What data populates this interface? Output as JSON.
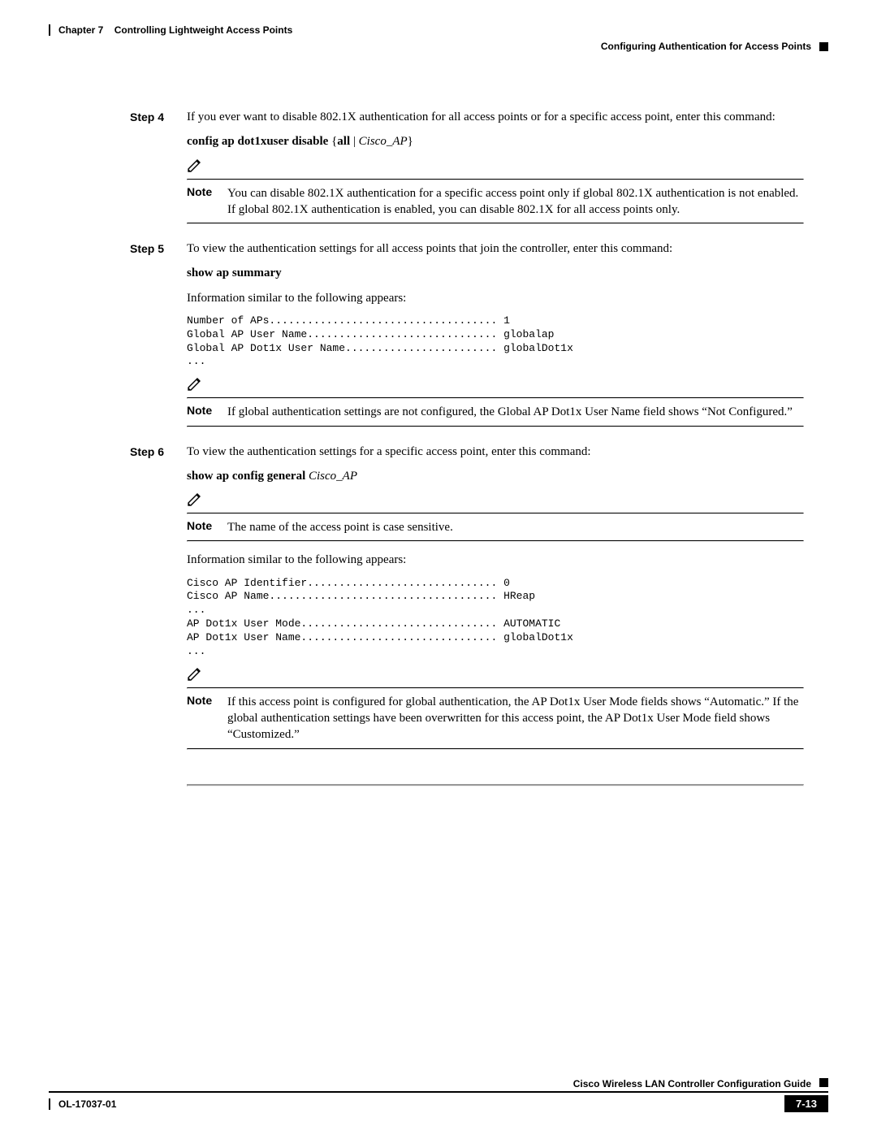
{
  "header": {
    "chapter_label": "Chapter 7",
    "chapter_title": "Controlling Lightweight Access Points",
    "section_title": "Configuring Authentication for Access Points"
  },
  "steps": {
    "s4": {
      "label": "Step 4",
      "intro": "If you ever want to disable 802.1X authentication for all access points or for a specific access point, enter this command:",
      "cmd_prefix": "config ap dot1xuser disable ",
      "cmd_brace_open": "{",
      "cmd_all": "all",
      "cmd_pipe": " | ",
      "cmd_arg": "Cisco_AP",
      "cmd_brace_close": "}",
      "note_label": "Note",
      "note_text": "You can disable 802.1X authentication for a specific access point only if global 802.1X authentication is not enabled. If global 802.1X authentication is enabled, you can disable 802.1X for all access points only."
    },
    "s5": {
      "label": "Step 5",
      "intro": "To view the authentication settings for all access points that join the controller, enter this command:",
      "cmd": "show ap summary",
      "info_line": "Information similar to the following appears:",
      "output": "Number of APs.................................... 1\nGlobal AP User Name.............................. globalap\nGlobal AP Dot1x User Name........................ globalDot1x\n...",
      "note_label": "Note",
      "note_text": "If global authentication settings are not configured, the Global AP Dot1x User Name field shows “Not Configured.”"
    },
    "s6": {
      "label": "Step 6",
      "intro": "To view the authentication settings for a specific access point, enter this command:",
      "cmd_prefix": "show ap config general ",
      "cmd_arg": "Cisco_AP",
      "note1_label": "Note",
      "note1_text": "The name of the access point is case sensitive.",
      "info_line": "Information similar to the following appears:",
      "output": "Cisco AP Identifier.............................. 0\nCisco AP Name.................................... HReap\n...\nAP Dot1x User Mode............................... AUTOMATIC\nAP Dot1x User Name............................... globalDot1x\n...",
      "note2_label": "Note",
      "note2_text": "If this access point is configured for global authentication, the AP Dot1x User Mode fields shows “Automatic.” If the global authentication settings have been overwritten for this access point, the AP Dot1x User Mode field shows “Customized.”"
    }
  },
  "footer": {
    "guide_title": "Cisco Wireless LAN Controller Configuration Guide",
    "doc_id": "OL-17037-01",
    "page_num": "7-13"
  }
}
